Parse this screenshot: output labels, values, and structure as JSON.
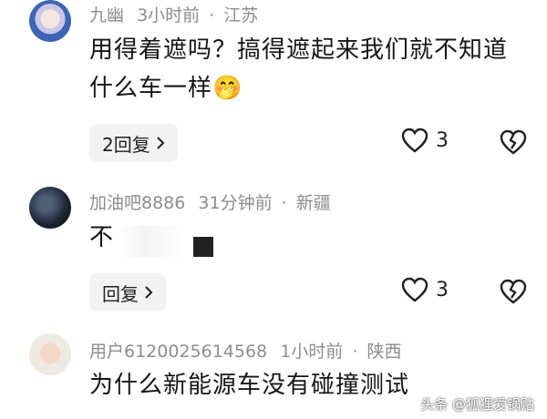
{
  "comments": [
    {
      "user": "九幽",
      "time": "3小时前",
      "location": "江苏",
      "text": "用得着遮吗？搞得遮起来我们就不知道什么车一样",
      "emoji": "🤭",
      "reply_label": "2回复",
      "likes": "3"
    },
    {
      "user": "加油吧8886",
      "time": "31分钟前",
      "location": "新疆",
      "text": "不",
      "reply_label": "回复",
      "likes": "3"
    },
    {
      "user": "用户6120025614568",
      "time": "1小时前",
      "location": "陕西",
      "text": "为什么新能源车没有碰撞测试"
    }
  ],
  "separator": "·",
  "watermark": "头条 @狐狸爱锅贴",
  "icons": {
    "like": "heart-outline-icon",
    "dislike": "broken-heart-icon",
    "chevron": "chevron-right-icon"
  },
  "colors": {
    "meta_text": "#8d8d8d",
    "reply_bg": "#f2f2f2"
  }
}
